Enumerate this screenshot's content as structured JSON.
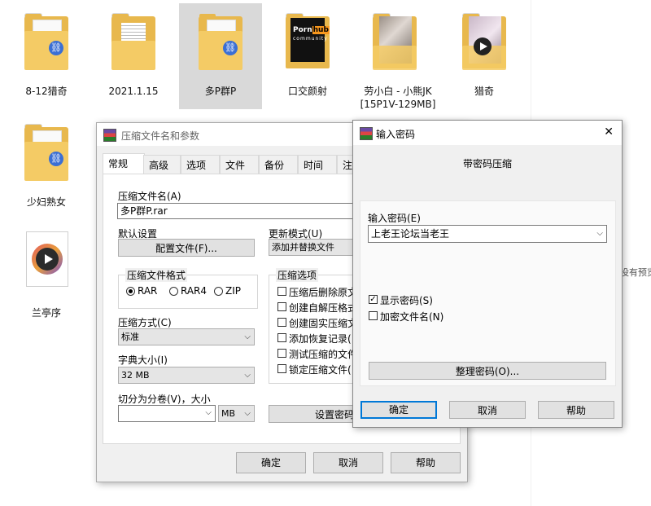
{
  "desktop": {
    "items": [
      {
        "label": "8-12猎奇"
      },
      {
        "label": "2021.1.15"
      },
      {
        "label": "多P群P"
      },
      {
        "label": "口交颜射"
      },
      {
        "label": "劳小白 - 小熊JK\n[15P1V-129MB]"
      },
      {
        "label": "猎奇"
      },
      {
        "label": "少妇熟女"
      },
      {
        "label": "兰亭序"
      }
    ],
    "thumb_text": {
      "porn": "Porn",
      "hub": "hub",
      "community": "community"
    },
    "preview_text": "没有预览"
  },
  "rar_dialog": {
    "title": "压缩文件名和参数",
    "tabs": [
      "常规",
      "高级",
      "选项",
      "文件",
      "备份",
      "时间",
      "注"
    ],
    "archive_name_label": "压缩文件名(A)",
    "archive_name_value": "多P群P.rar",
    "default_settings_label": "默认设置",
    "profiles_button": "配置文件(F)...",
    "update_mode_label": "更新模式(U)",
    "update_mode_value": "添加并替换文件",
    "format_group": "压缩文件格式",
    "formats": [
      "RAR",
      "RAR4",
      "ZIP"
    ],
    "selected_format": "RAR",
    "options_group": "压缩选项",
    "options": [
      "压缩后删除原文",
      "创建自解压格式",
      "创建固实压缩文",
      "添加恢复记录(",
      "测试压缩的文件",
      "锁定压缩文件("
    ],
    "method_label": "压缩方式(C)",
    "method_value": "标准",
    "dict_label": "字典大小(I)",
    "dict_value": "32 MB",
    "split_label": "切分为分卷(V)，大小",
    "split_value": "",
    "split_unit": "MB",
    "set_password_button": "设置密码",
    "ok": "确定",
    "cancel": "取消",
    "help": "帮助"
  },
  "pwd_dialog": {
    "title": "输入密码",
    "close": "✕",
    "heading": "带密码压缩",
    "pwd_label": "输入密码(E)",
    "pwd_value": "上老王论坛当老王",
    "show_password": "显示密码(S)",
    "show_password_checked": true,
    "encrypt_names": "加密文件名(N)",
    "encrypt_names_checked": false,
    "organize_button": "整理密码(O)...",
    "ok": "确定",
    "cancel": "取消",
    "help": "帮助"
  },
  "colors": {
    "accent": "#0078d7",
    "folder": "#f4cb65",
    "selection": "#d9d9d9"
  }
}
